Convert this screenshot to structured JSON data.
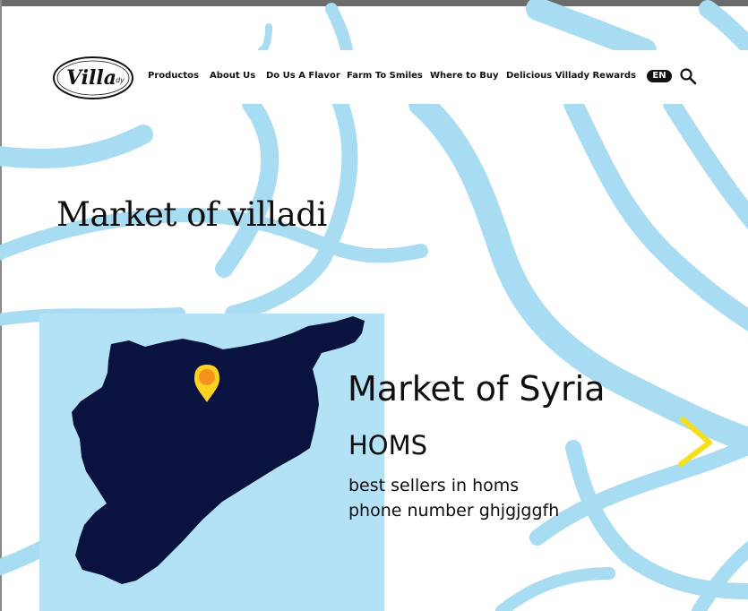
{
  "brand": {
    "logo_text": "Villa",
    "logo_suffix": "dy"
  },
  "nav": {
    "items": [
      "Productos",
      "About Us",
      "Do Us A Flavor",
      "Farm To Smiles",
      "Where to Buy",
      "Delicious Villady Rewards"
    ],
    "language": "EN"
  },
  "page": {
    "title": "Market of villadi"
  },
  "market": {
    "title": "Market of Syria",
    "city": "HOMS",
    "description": "best sellers in homs",
    "phone": "phone number ghjgjggfh"
  },
  "colors": {
    "wave": "#a8dcf2",
    "panel": "#b3e1f5",
    "map_fill": "#0a1240",
    "pin": "#ffd21f",
    "pin_dot": "#f5921e",
    "arrow": "#f7de1c"
  },
  "icons": {
    "search": "search-icon",
    "next": "chevron-right-icon",
    "pin": "location-pin-icon"
  }
}
